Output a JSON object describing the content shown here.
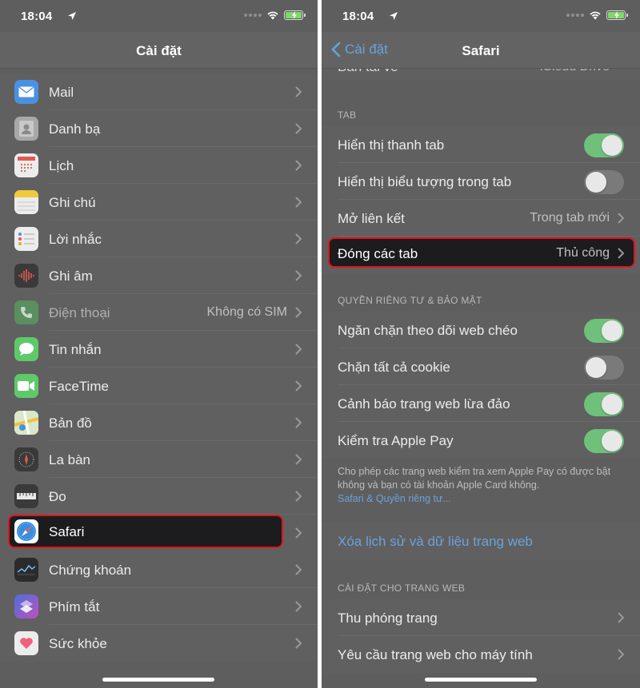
{
  "status_bar": {
    "time": "18:04"
  },
  "left": {
    "nav_title": "Cài đặt",
    "items": [
      {
        "label": "Mail",
        "icon": "mail-icon",
        "color": "#4a90e2"
      },
      {
        "label": "Danh bạ",
        "icon": "contacts-icon",
        "color": "#9a9a9a"
      },
      {
        "label": "Lịch",
        "icon": "calendar-icon",
        "color": "#ffffff"
      },
      {
        "label": "Ghi chú",
        "icon": "notes-icon",
        "color": "#f5d04a"
      },
      {
        "label": "Lời nhắc",
        "icon": "reminders-icon",
        "color": "#ffffff"
      },
      {
        "label": "Ghi âm",
        "icon": "voice-memos-icon",
        "color": "#2b2b2b"
      },
      {
        "label": "Điện thoại",
        "value": "Không có SIM",
        "icon": "phone-icon",
        "color": "#5fbf6c",
        "dimmed": true
      },
      {
        "label": "Tin nhắn",
        "icon": "messages-icon",
        "color": "#5fc96a"
      },
      {
        "label": "FaceTime",
        "icon": "facetime-icon",
        "color": "#5fc96a"
      },
      {
        "label": "Bản đồ",
        "icon": "maps-icon",
        "color": "#e8e4d8"
      },
      {
        "label": "La bàn",
        "icon": "compass-icon",
        "color": "#2b2b2b"
      },
      {
        "label": "Đo",
        "icon": "measure-icon",
        "color": "#2b2b2b"
      },
      {
        "label": "Safari",
        "icon": "safari-icon",
        "color": "#ffffff",
        "highlighted": true
      },
      {
        "label": "Chứng khoán",
        "icon": "stocks-icon",
        "color": "#2b2b2b"
      },
      {
        "label": "Phím tắt",
        "icon": "shortcuts-icon",
        "color": "#8a5cd6"
      },
      {
        "label": "Sức khỏe",
        "icon": "health-icon",
        "color": "#ffffff"
      }
    ]
  },
  "right": {
    "nav_title": "Safari",
    "back_label": "Cài đặt",
    "top_partial": "Bản tải về",
    "top_partial_value": "iCloud Drive",
    "section_tab": "TAB",
    "tab_rows": [
      {
        "label": "Hiển thị thanh tab",
        "toggle": true
      },
      {
        "label": "Hiển thị biểu tượng trong tab",
        "toggle": false
      },
      {
        "label": "Mở liên kết",
        "value": "Trong tab mới"
      },
      {
        "label": "Đóng các tab",
        "value": "Thủ công",
        "highlighted": true
      }
    ],
    "section_privacy": "QUYỀN RIÊNG TƯ & BẢO MẬT",
    "privacy_rows": [
      {
        "label": "Ngăn chặn theo dõi web chéo",
        "toggle": true
      },
      {
        "label": "Chặn tất cả cookie",
        "toggle": false
      },
      {
        "label": "Cảnh báo trang web lừa đảo",
        "toggle": true
      },
      {
        "label": "Kiểm tra Apple Pay",
        "toggle": true
      }
    ],
    "footnote": "Cho phép các trang web kiểm tra xem Apple Pay có được bật không và bạn có tài khoản Apple Card không.",
    "footnote_link": "Safari & Quyền riêng tư...",
    "clear_history": "Xóa lịch sử và dữ liệu trang web",
    "section_websites": "CÀI ĐẶT CHO TRANG WEB",
    "website_rows": [
      {
        "label": "Thu phóng trang"
      },
      {
        "label": "Yêu cầu trang web cho máy tính"
      }
    ]
  },
  "colors": {
    "toggle_on": "#6fc07a",
    "link": "#6aa2dc",
    "highlight_border": "#e0141b"
  }
}
